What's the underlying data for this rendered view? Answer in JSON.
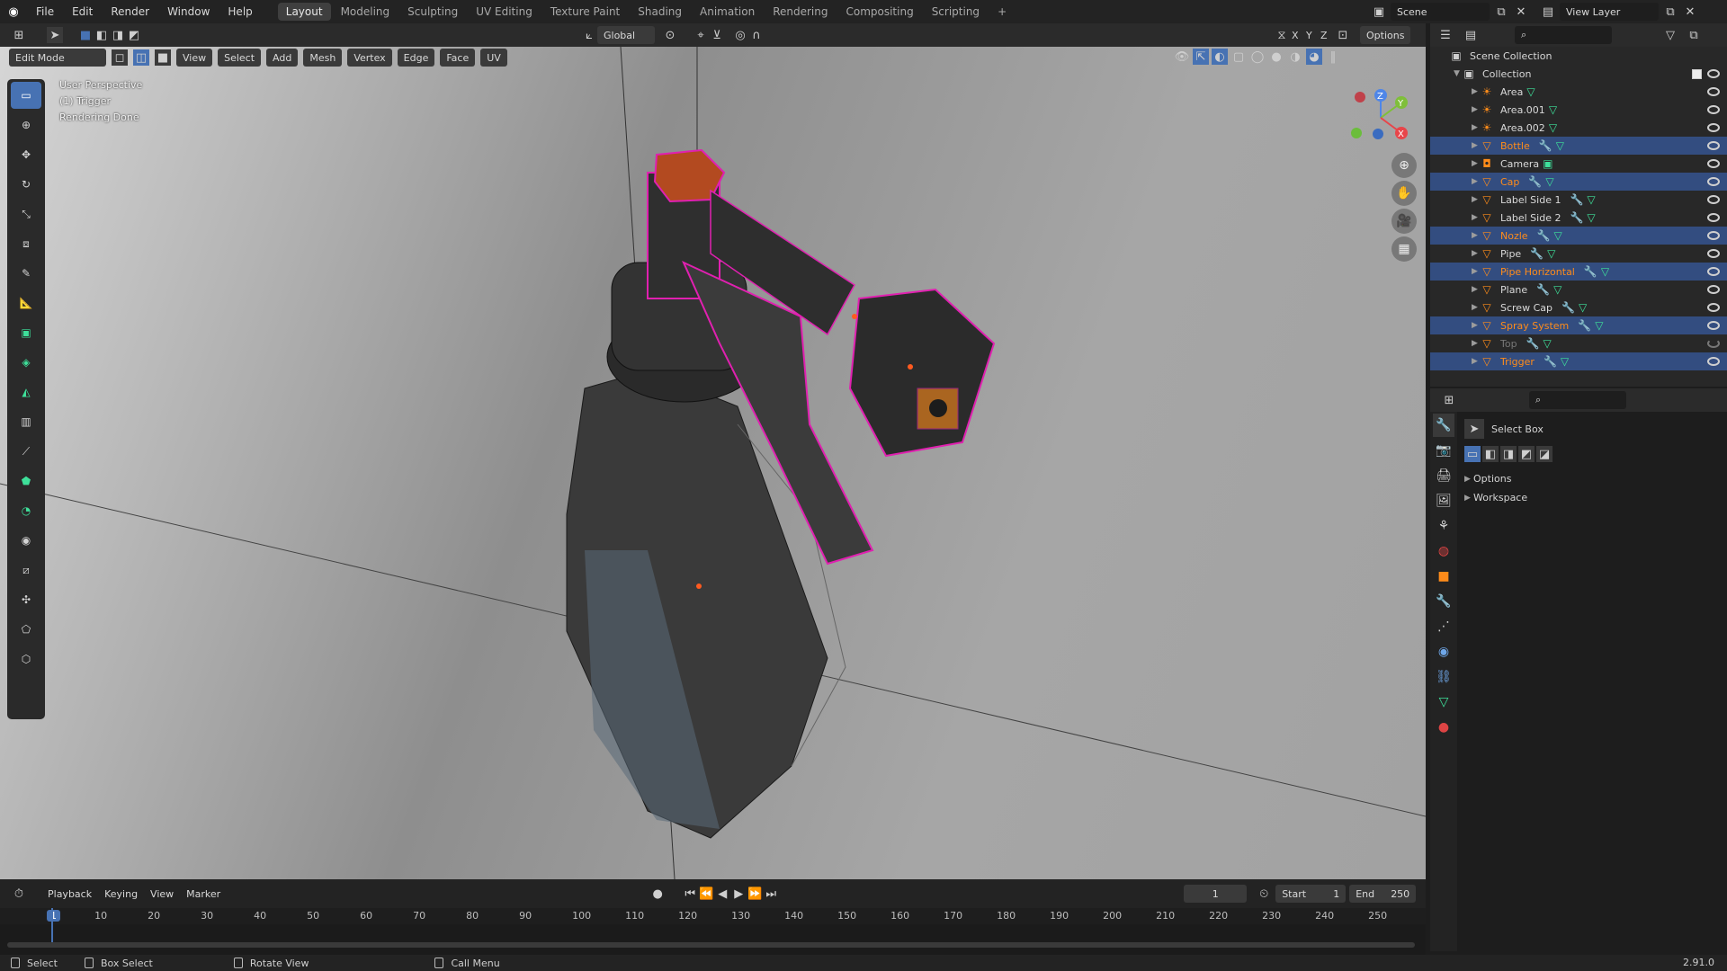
{
  "menus": [
    "File",
    "Edit",
    "Render",
    "Window",
    "Help"
  ],
  "workspaces": [
    "Layout",
    "Modeling",
    "Sculpting",
    "UV Editing",
    "Texture Paint",
    "Shading",
    "Animation",
    "Rendering",
    "Compositing",
    "Scripting"
  ],
  "scene": {
    "label": "Scene",
    "view_layer": "View Layer"
  },
  "viewport_header": {
    "mode": "Edit Mode",
    "menus": [
      "View",
      "Select",
      "Add",
      "Mesh",
      "Vertex",
      "Edge",
      "Face",
      "UV"
    ],
    "orientation": "Global",
    "options_label": "Options",
    "axes": [
      "X",
      "Y",
      "Z"
    ]
  },
  "viewport_overlay": {
    "line1": "User Perspective",
    "line2": "(1) Trigger",
    "line3": "Rendering Done"
  },
  "gizmo": {
    "z": "Z",
    "y": "Y",
    "x": "X"
  },
  "outliner": {
    "root": "Scene Collection",
    "collection": "Collection",
    "items": [
      {
        "name": "Area",
        "selected": false,
        "type": "light"
      },
      {
        "name": "Area.001",
        "selected": false,
        "type": "light"
      },
      {
        "name": "Area.002",
        "selected": false,
        "type": "light"
      },
      {
        "name": "Bottle",
        "selected": true,
        "type": "mesh"
      },
      {
        "name": "Camera",
        "selected": false,
        "type": "camera"
      },
      {
        "name": "Cap",
        "selected": true,
        "type": "mesh"
      },
      {
        "name": "Label Side 1",
        "selected": false,
        "type": "mesh"
      },
      {
        "name": "Label Side 2",
        "selected": false,
        "type": "mesh"
      },
      {
        "name": "Nozle",
        "selected": true,
        "type": "mesh"
      },
      {
        "name": "Pipe",
        "selected": false,
        "type": "mesh"
      },
      {
        "name": "Pipe Horizontal",
        "selected": true,
        "type": "mesh"
      },
      {
        "name": "Plane",
        "selected": false,
        "type": "mesh"
      },
      {
        "name": "Screw Cap",
        "selected": false,
        "type": "mesh"
      },
      {
        "name": "Spray System",
        "selected": true,
        "type": "mesh"
      },
      {
        "name": "Top",
        "selected": false,
        "type": "mesh",
        "hidden": true
      },
      {
        "name": "Trigger",
        "selected": true,
        "type": "mesh",
        "active": true
      }
    ]
  },
  "properties": {
    "tool_name": "Select Box",
    "sections": [
      "Options",
      "Workspace"
    ]
  },
  "timeline": {
    "menus": [
      "Playback",
      "Keying",
      "View",
      "Marker"
    ],
    "current_frame": "1",
    "start_label": "Start",
    "start": "1",
    "end_label": "End",
    "end": "250",
    "ruler": [
      "1",
      "10",
      "20",
      "30",
      "40",
      "50",
      "60",
      "70",
      "80",
      "90",
      "100",
      "110",
      "120",
      "130",
      "140",
      "150",
      "160",
      "170",
      "180",
      "190",
      "200",
      "210",
      "220",
      "230",
      "240",
      "250"
    ]
  },
  "statusbar": {
    "select": "Select",
    "box_select": "Box Select",
    "rotate": "Rotate View",
    "call_menu": "Call Menu",
    "version": "2.91.0"
  },
  "colors": {
    "accent": "#4772b3",
    "selected_row": "#334d80",
    "orange": "#ff8c1a",
    "edit_pink": "#e020b0"
  }
}
